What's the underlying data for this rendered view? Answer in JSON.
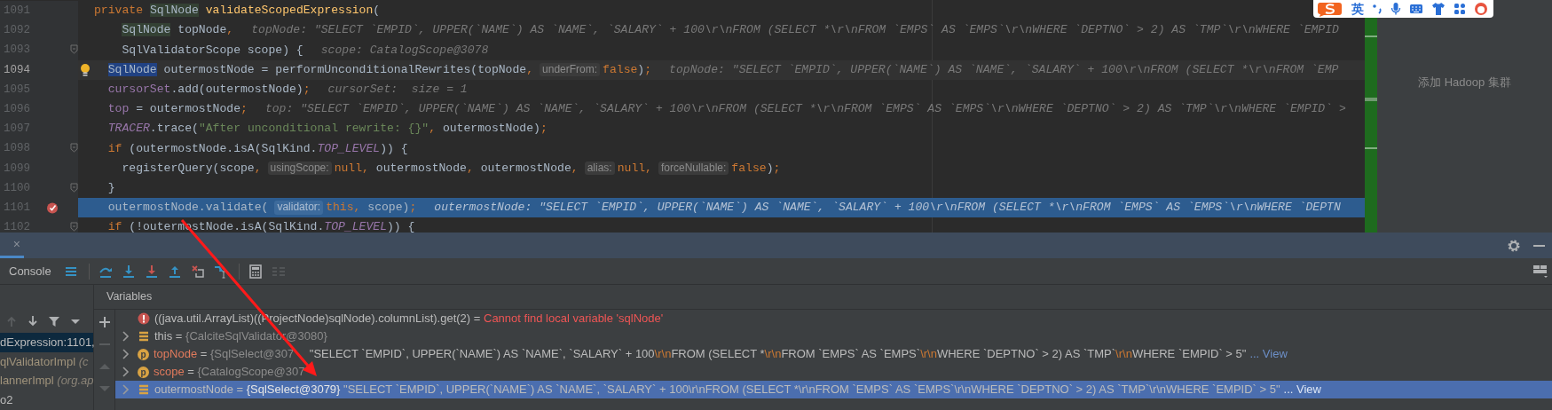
{
  "editor": {
    "lines": [
      {
        "number": "1091",
        "kind": "signature",
        "current": false,
        "execution": false,
        "segments": [
          {
            "kind": "code",
            "tokens": [
              {
                "kind": "keyword",
                "text": "private "
              },
              {
                "kind": "usage",
                "text": "SqlNode"
              },
              {
                "kind": "method",
                "text": " validateScopedExpression"
              },
              {
                "kind": "plain",
                "text": "("
              }
            ]
          }
        ]
      },
      {
        "number": "1092",
        "kind": "parameter",
        "current": false,
        "execution": false,
        "segments": [
          {
            "kind": "code",
            "tokens": [
              {
                "kind": "usage",
                "text": "SqlNode"
              },
              {
                "kind": "plain",
                "text": " topNode"
              },
              {
                "kind": "keyword",
                "text": ","
              }
            ]
          },
          {
            "kind": "value",
            "text": "topNode: \"SELECT `EMPID`, UPPER(`NAME`) AS `NAME`, `SALARY` + 100\\r\\nFROM (SELECT *\\r\\nFROM `EMPS` AS `EMPS`\\r\\nWHERE `DEPTNO` > 2) AS `TMP`\\r\\nWHERE `EMPID"
          }
        ]
      },
      {
        "number": "1093",
        "kind": "parameter",
        "current": false,
        "execution": false,
        "marker": {
          "kind": "fold"
        },
        "segments": [
          {
            "kind": "code",
            "tokens": [
              {
                "kind": "plain",
                "text": "SqlValidatorScope scope) {"
              }
            ]
          },
          {
            "kind": "value",
            "text": "scope: CatalogScope@3078"
          }
        ]
      },
      {
        "number": "1094",
        "kind": "statement",
        "current": true,
        "execution": false,
        "marker": {
          "kind": "bulb"
        },
        "segments": [
          {
            "kind": "code",
            "tokens": [
              {
                "kind": "caret",
                "text": "SqlNode"
              },
              {
                "kind": "plain",
                "text": " outermostNode = performUnconditionalRewrites(topNode"
              },
              {
                "kind": "keyword",
                "text": ","
              }
            ]
          },
          {
            "kind": "inlay",
            "text": "underFrom:"
          },
          {
            "kind": "code",
            "tokens": [
              {
                "kind": "keyword",
                "text": "false"
              },
              {
                "kind": "plain",
                "text": ")"
              },
              {
                "kind": "keyword",
                "text": ";"
              }
            ]
          },
          {
            "kind": "value",
            "text": "topNode: \"SELECT `EMPID`, UPPER(`NAME`) AS `NAME`, `SALARY` + 100\\r\\nFROM (SELECT *\\r\\nFROM `EMP"
          }
        ]
      },
      {
        "number": "1095",
        "kind": "statement",
        "current": false,
        "execution": false,
        "segments": [
          {
            "kind": "code",
            "tokens": [
              {
                "kind": "field",
                "text": "cursorSet"
              },
              {
                "kind": "plain",
                "text": ".add(outermostNode)"
              },
              {
                "kind": "keyword",
                "text": ";"
              }
            ]
          },
          {
            "kind": "value",
            "text": "cursorSet:  size = 1"
          }
        ]
      },
      {
        "number": "1096",
        "kind": "statement",
        "current": false,
        "execution": false,
        "segments": [
          {
            "kind": "code",
            "tokens": [
              {
                "kind": "field",
                "text": "top"
              },
              {
                "kind": "plain",
                "text": " = outermostNode"
              },
              {
                "kind": "keyword",
                "text": ";"
              }
            ]
          },
          {
            "kind": "value",
            "text": "top: \"SELECT `EMPID`, UPPER(`NAME`) AS `NAME`, `SALARY` + 100\\r\\nFROM (SELECT *\\r\\nFROM `EMPS` AS `EMPS`\\r\\nWHERE `DEPTNO` > 2) AS `TMP`\\r\\nWHERE `EMPID` >"
          }
        ]
      },
      {
        "number": "1097",
        "kind": "statement",
        "current": false,
        "execution": false,
        "segments": [
          {
            "kind": "code",
            "tokens": [
              {
                "kind": "constant",
                "text": "TRACER"
              },
              {
                "kind": "plain",
                "text": ".trace("
              },
              {
                "kind": "string",
                "text": "\"After unconditional rewrite: {}\""
              },
              {
                "kind": "keyword",
                "text": ","
              },
              {
                "kind": "plain",
                "text": " outermostNode)"
              },
              {
                "kind": "keyword",
                "text": ";"
              }
            ]
          }
        ]
      },
      {
        "number": "1098",
        "kind": "statement",
        "current": false,
        "execution": false,
        "marker": {
          "kind": "fold"
        },
        "segments": [
          {
            "kind": "code",
            "tokens": [
              {
                "kind": "keyword",
                "text": "if"
              },
              {
                "kind": "plain",
                "text": " (outermostNode.isA(SqlKind."
              },
              {
                "kind": "constant",
                "text": "TOP_LEVEL"
              },
              {
                "kind": "plain",
                "text": ")) {"
              }
            ]
          }
        ]
      },
      {
        "number": "1099",
        "kind": "nested",
        "current": false,
        "execution": false,
        "segments": [
          {
            "kind": "code",
            "tokens": [
              {
                "kind": "plain",
                "text": "registerQuery(scope"
              },
              {
                "kind": "keyword",
                "text": ","
              }
            ]
          },
          {
            "kind": "inlay",
            "text": "usingScope:"
          },
          {
            "kind": "code",
            "tokens": [
              {
                "kind": "keyword",
                "text": "null,"
              },
              {
                "kind": "plain",
                "text": " outermostNode"
              },
              {
                "kind": "keyword",
                "text": ","
              },
              {
                "kind": "plain",
                "text": " outermostNode"
              },
              {
                "kind": "keyword",
                "text": ","
              }
            ]
          },
          {
            "kind": "inlay",
            "text": "alias:"
          },
          {
            "kind": "code",
            "tokens": [
              {
                "kind": "keyword",
                "text": "null,"
              }
            ]
          },
          {
            "kind": "inlay",
            "text": "forceNullable:"
          },
          {
            "kind": "code",
            "tokens": [
              {
                "kind": "keyword",
                "text": "false"
              },
              {
                "kind": "plain",
                "text": ")"
              },
              {
                "kind": "keyword",
                "text": ";"
              }
            ]
          }
        ]
      },
      {
        "number": "1100",
        "kind": "statement",
        "current": false,
        "execution": false,
        "marker": {
          "kind": "fold"
        },
        "segments": [
          {
            "kind": "code",
            "tokens": [
              {
                "kind": "plain",
                "text": "}"
              }
            ]
          }
        ]
      },
      {
        "number": "1101",
        "kind": "statement",
        "current": false,
        "execution": true,
        "marker": {
          "kind": "breakpoint"
        },
        "segments": [
          {
            "kind": "code",
            "tokens": [
              {
                "kind": "plain",
                "text": "outermostNode.validate("
              }
            ]
          },
          {
            "kind": "inlay",
            "text": "validator:"
          },
          {
            "kind": "code",
            "tokens": [
              {
                "kind": "keyword",
                "text": "this,"
              },
              {
                "kind": "plain",
                "text": " scope)"
              },
              {
                "kind": "keyword",
                "text": ";"
              }
            ]
          },
          {
            "kind": "value",
            "text": "outermostNode: \"SELECT `EMPID`, UPPER(`NAME`) AS `NAME`, `SALARY` + 100\\r\\nFROM (SELECT *\\r\\nFROM `EMPS` AS `EMPS`\\r\\nWHERE `DEPTN"
          }
        ]
      },
      {
        "number": "1102",
        "kind": "statement",
        "current": false,
        "execution": false,
        "marker": {
          "kind": "fold"
        },
        "segments": [
          {
            "kind": "code",
            "tokens": [
              {
                "kind": "keyword",
                "text": "if"
              },
              {
                "kind": "plain",
                "text": " (!outermostNode.isA(SqlKind."
              },
              {
                "kind": "constant",
                "text": "TOP_LEVEL"
              },
              {
                "kind": "plain",
                "text": ")) {"
              }
            ]
          }
        ]
      }
    ]
  },
  "ime_toolbar": {
    "mode": "英"
  },
  "right_panel": {
    "text": "添加 Hadoop 集群"
  },
  "debug": {
    "tab": {
      "close": "×",
      "selected": true
    },
    "toolbar": {
      "console": "Console",
      "items": [
        {
          "kind": "menu",
          "disabled": false
        },
        {
          "kind": "step-over",
          "disabled": false
        },
        {
          "kind": "step-into",
          "disabled": false
        },
        {
          "kind": "force-step-into",
          "disabled": false
        },
        {
          "kind": "step-out",
          "disabled": false
        },
        {
          "kind": "drop-frame",
          "disabled": false
        },
        {
          "kind": "run-to-cursor",
          "disabled": false
        },
        {
          "kind": "evaluate",
          "disabled": false
        },
        {
          "kind": "trace",
          "disabled": true
        }
      ]
    },
    "frames_toolbar": [
      {
        "kind": "up",
        "disabled": true
      },
      {
        "kind": "down",
        "disabled": false
      },
      {
        "kind": "filter",
        "disabled": false
      },
      {
        "kind": "caret",
        "disabled": false
      }
    ],
    "frames": [
      {
        "method": "dExpression:1101,",
        "selected": true,
        "library": false
      },
      {
        "method": "qlValidatorImpl",
        "location": "(c",
        "selected": false,
        "library": true
      },
      {
        "method": "lannerImpl",
        "location": "(org.ap",
        "selected": false,
        "library": true
      },
      {
        "method": "o2",
        "selected": false,
        "library": false
      }
    ],
    "variables_title": "Variables",
    "variables_toolbar": [
      {
        "kind": "add",
        "disabled": false
      },
      {
        "kind": "remove",
        "disabled": true
      },
      {
        "kind": "up",
        "disabled": true
      },
      {
        "kind": "down",
        "disabled": true
      }
    ],
    "variables": [
      {
        "kind": "error",
        "expandable": false,
        "selected": false,
        "name": "((java.util.ArrayList)((ProjectNode)sqlNode).columnList).get(2)",
        "separator": " = ",
        "message": "Cannot find local variable 'sqlNode'"
      },
      {
        "kind": "field",
        "expandable": true,
        "selected": false,
        "name": "this",
        "separator": " = ",
        "type_info": "{CalciteSqlValidator@3080}"
      },
      {
        "kind": "param",
        "badge": "p",
        "expandable": true,
        "selected": false,
        "name": "topNode",
        "separator": " = ",
        "type_info": "{SqlSelect@307",
        "value_parts": [
          {
            "text": "\"SELECT `EMPID`, UPPER(`NAME`) AS `NAME`, `SALARY` + 100",
            "escape": false
          },
          {
            "text": "\\r\\n",
            "escape": true
          },
          {
            "text": "FROM (SELECT *",
            "escape": false
          },
          {
            "text": "\\r\\n",
            "escape": true
          },
          {
            "text": "FROM `EMPS` AS `EMPS`",
            "escape": false
          },
          {
            "text": "\\r\\n",
            "escape": true
          },
          {
            "text": "WHERE `DEPTNO` > 2) AS `TMP`",
            "escape": false
          },
          {
            "text": "\\r\\n",
            "escape": true
          },
          {
            "text": "WHERE `EMPID` > 5\"",
            "escape": false
          }
        ],
        "link": "... View"
      },
      {
        "kind": "param",
        "badge": "p",
        "expandable": true,
        "selected": false,
        "name": "scope",
        "separator": " = ",
        "type_info": "{CatalogScope@307"
      },
      {
        "kind": "field",
        "expandable": true,
        "selected": true,
        "name": "outermostNode",
        "separator": " = ",
        "type_info": "{SqlSelect@3079}",
        "value": "\"SELECT `EMPID`, UPPER(`NAME`) AS `NAME`, `SALARY` + 100\\r\\nFROM (SELECT *\\r\\nFROM `EMPS` AS `EMPS`\\r\\nWHERE `DEPTNO` > 2) AS `TMP`\\r\\nWHERE `EMPID` > 5\"",
        "link": "... View"
      }
    ]
  }
}
